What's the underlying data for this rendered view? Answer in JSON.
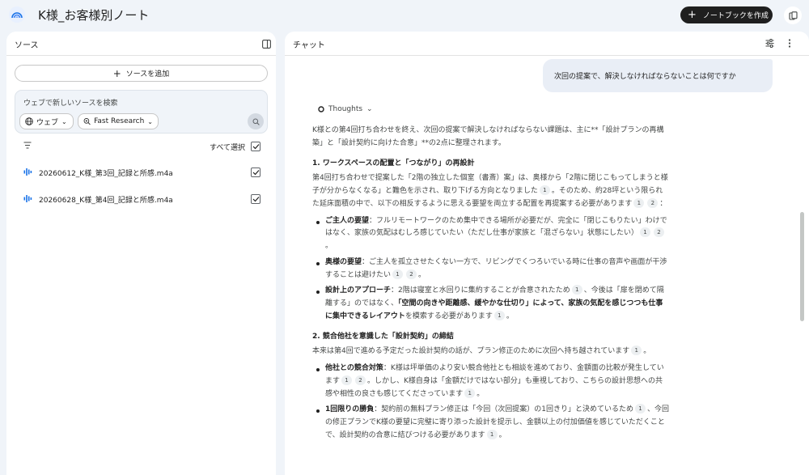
{
  "header": {
    "title": "K様_お客様別ノート",
    "create_label": "ノートブックを作成",
    "logo_icon": "notebooklm-logo-icon"
  },
  "sources": {
    "title": "ソース",
    "add_label": "ソースを追加",
    "search_placeholder": "ウェブで新しいソースを検索",
    "web_label": "ウェブ",
    "research_label": "Fast Research",
    "select_all_label": "すべて選択",
    "items": [
      {
        "name": "20260612_K様_第3回_記録と所感.m4a",
        "checked": true,
        "icon": "audio-icon"
      },
      {
        "name": "20260628_K様_第4回_記録と所感.m4a",
        "checked": true,
        "icon": "audio-icon"
      }
    ]
  },
  "chat": {
    "title": "チャット",
    "user_message": "次回の提案で、解決しなければならないことは何ですか",
    "thoughts_label": "Thoughts",
    "intro_a": "K様との第4回打ち合わせを終え、次回の提案で解決しなければならない課題は、主に**「設計プランの再構築」と「設計契約に向けた合意」**の2点に整理されます。",
    "s1_heading": "1. ワークスペースの配置と「つながり」の再設計",
    "s1_para_a": "第4回打ち合わせで提案した「2階の独立した個室（書斎）案」は、奥様から「2階に閉じこもってしまうと様子が分からなくなる」と難色を示され、取り下げる方向となりました",
    "s1_para_b": "。そのため、約28坪という限られた延床面積の中で、以下の相反するように思える要望を両立する配置を再提案する必要があります",
    "s1_para_c": "：",
    "b1_label": "ご主人の要望",
    "b1_text": "：フルリモートワークのため集中できる場所が必要だが、完全に「閉じこもりたい」わけではなく、家族の気配はむしろ感じていたい（ただし仕事が家族と「混ざらない」状態にしたい）",
    "b2_label": "奥様の要望",
    "b2_text": "：ご主人を孤立させたくない一方で、リビングでくつろいでいる時に仕事の音声や画面が干渉することは避けたい",
    "b3_label": "設計上のアプローチ",
    "b3_text_a": "：2階は寝室と水回りに集約することが合意されたため",
    "b3_text_b": "、今後は「扉を閉めて隔離する」のではなく、",
    "b3_strong": "「空間の向きや距離感、緩やかな仕切り」によって、家族の気配を感じつつも仕事に集中できるレイアウト",
    "b3_text_c": "を模索する必要があります",
    "s2_heading": "2. 競合他社を意識した「設計契約」の締結",
    "s2_para": "本来は第4回で進める予定だった設計契約の話が、プラン修正のために次回へ持ち越されています",
    "b4_label": "他社との競合対策",
    "b4_text_a": "：K様は坪単価のより安い競合他社とも相談を進めており、金額面の比較が発生しています",
    "b4_text_b": "。しかし、K様自身は「金額だけではない部分」も重視しており、こちらの設計思想への共感や相性の良さも感じてくださっています",
    "b5_label": "1回限りの勝負",
    "b5_text_a": "：契約前の無料プラン修正は「今回（次回提案）の1回きり」と決めているため",
    "b5_text_b": "、今回の修正プランでK様の要望に完璧に寄り添った設計を提示し、金額以上の付加価値を感じていただくことで、設計契約の合意に結びつける必要があります",
    "c1": "1",
    "c2": "2",
    "period": "。"
  }
}
